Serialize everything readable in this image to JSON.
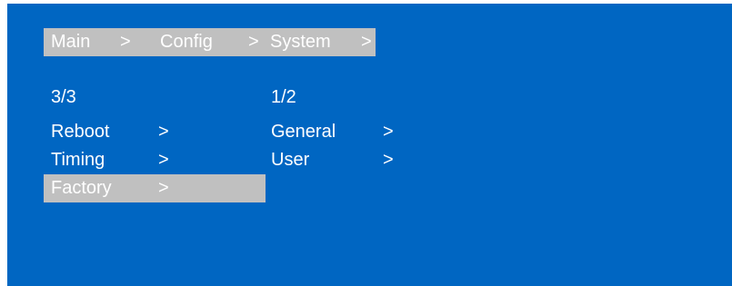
{
  "colors": {
    "background": "#0066c2",
    "highlight": "#c0c0c0",
    "text": "#ffffff"
  },
  "breadcrumb": {
    "main": "Main",
    "sep1": ">",
    "config": "Config",
    "sep2": ">",
    "system": "System",
    "sep3": ">"
  },
  "left_menu": {
    "page": "3/3",
    "items": [
      {
        "label": "Reboot",
        "arrow": ">"
      },
      {
        "label": "Timing",
        "arrow": ">"
      },
      {
        "label": "Factory",
        "arrow": ">",
        "selected": true
      }
    ]
  },
  "right_menu": {
    "page": "1/2",
    "items": [
      {
        "label": "General",
        "arrow": ">"
      },
      {
        "label": "User",
        "arrow": ">"
      }
    ]
  }
}
